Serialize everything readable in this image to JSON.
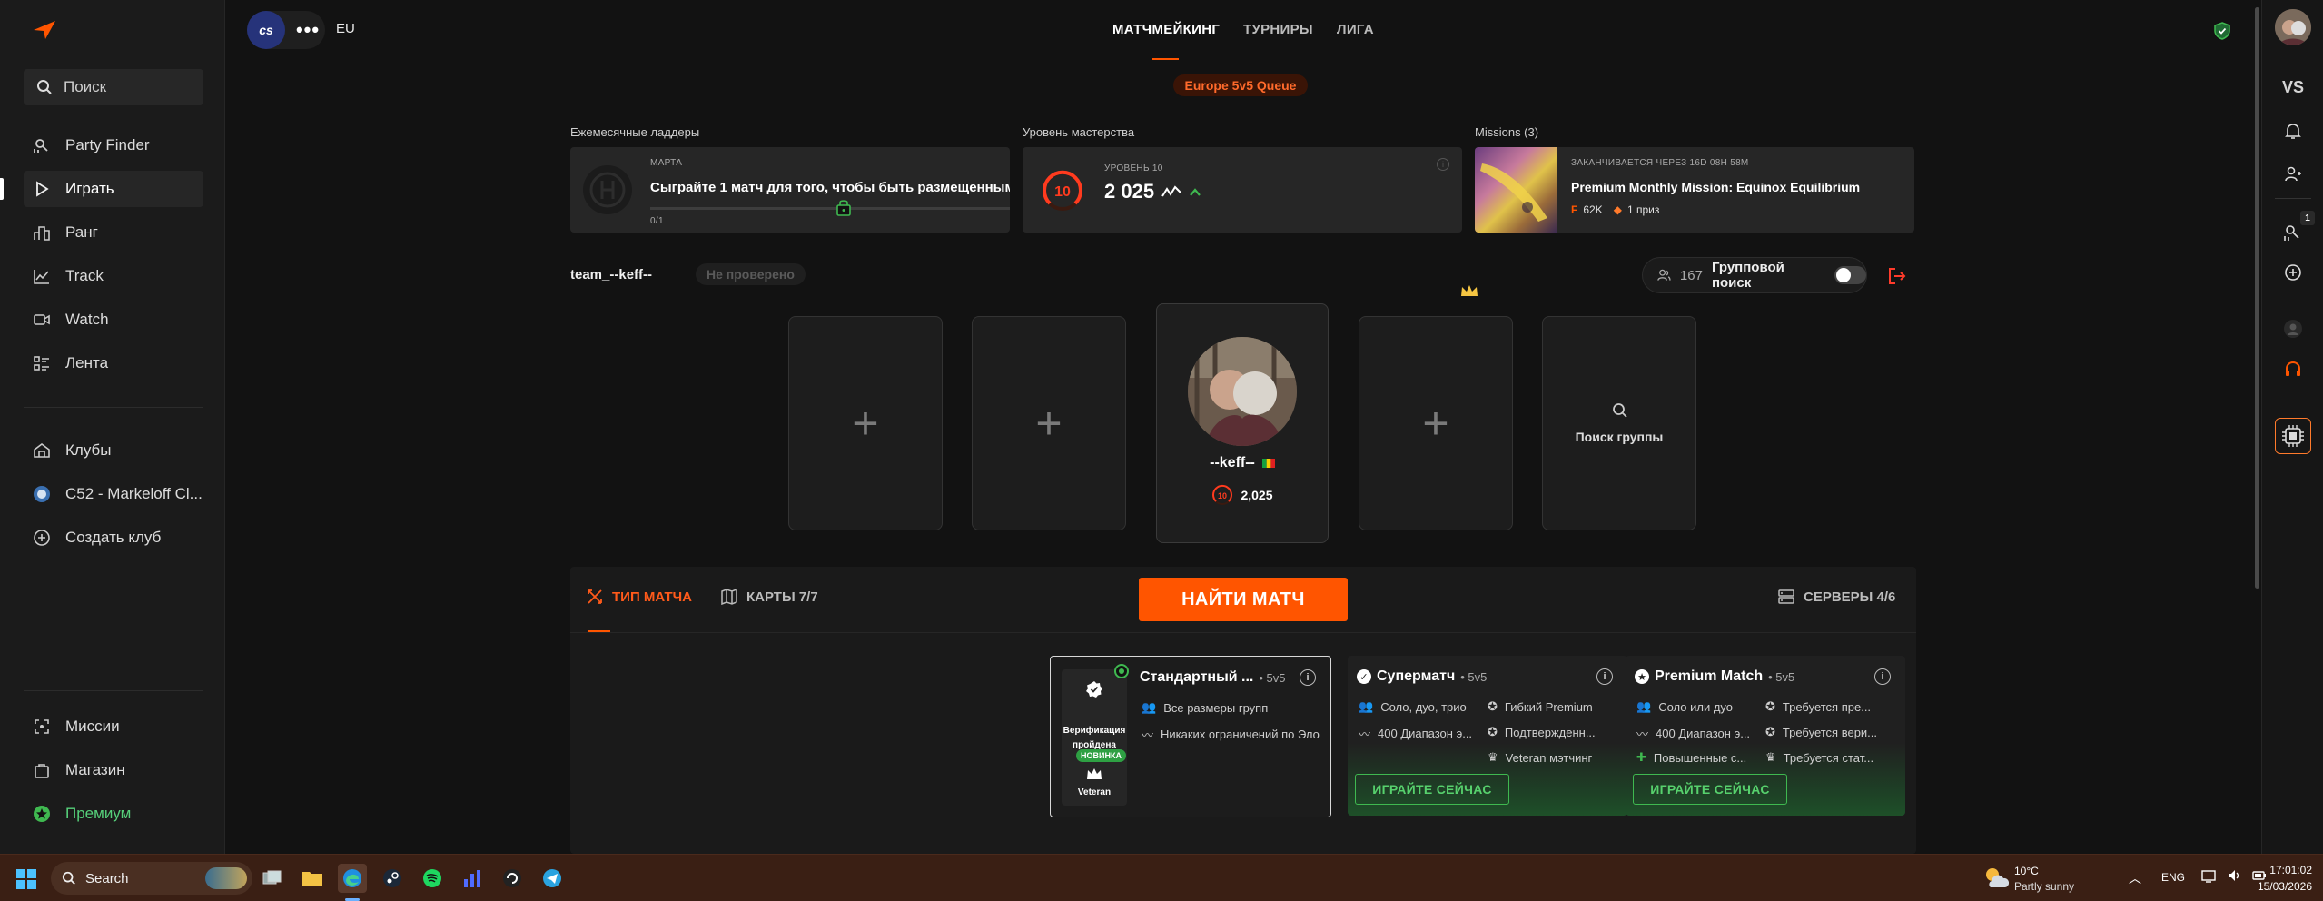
{
  "sidebar": {
    "search_label": "Поиск",
    "nav": [
      {
        "label": "Party Finder",
        "icon": "party-finder-icon"
      },
      {
        "label": "Играть",
        "icon": "play-icon"
      },
      {
        "label": "Ранг",
        "icon": "rank-icon"
      },
      {
        "label": "Track",
        "icon": "track-icon"
      },
      {
        "label": "Watch",
        "icon": "watch-icon"
      },
      {
        "label": "Лента",
        "icon": "feed-icon"
      }
    ],
    "clubs": [
      {
        "label": "Клубы"
      },
      {
        "label": "C52 - Markeloff Cl..."
      },
      {
        "label": "Создать клуб"
      }
    ],
    "bottom": [
      {
        "label": "Миссии"
      },
      {
        "label": "Магазин"
      },
      {
        "label": "Премиум"
      }
    ]
  },
  "topbar": {
    "game_logo": "cs",
    "region": "EU",
    "tabs": [
      "МАТЧМЕЙКИНГ",
      "ТУРНИРЫ",
      "ЛИГА"
    ],
    "active_tab": "МАТЧМЕЙКИНГ"
  },
  "queue_badge": "Europe 5v5 Queue",
  "ladder": {
    "section_label": "Ежемесячные ладдеры",
    "month": "МАРТА",
    "text": "Сыграйте 1 матч для того, чтобы быть размещенным",
    "progress": "0/1"
  },
  "mastery": {
    "section_label": "Уровень мастерства",
    "level_label": "УРОВЕНЬ 10",
    "level": "10",
    "elo": "2 025"
  },
  "missions": {
    "section_label": "Missions (3)",
    "ends": "ЗАКАНЧИВАЕТСЯ ЧЕРЕЗ 16D 08H 58M",
    "title": "Premium Monthly Mission: Equinox Equilibrium",
    "points": "62K",
    "prize": "1 приз"
  },
  "party": {
    "team_name": "team_--keff--",
    "verification": "Не проверено",
    "group_count": "167",
    "group_search_label": "Групповой поиск",
    "player_name": "--keff--",
    "player_level": "10",
    "player_elo": "2,025",
    "search_group_label": "Поиск группы"
  },
  "match_panel": {
    "tab_type": "ТИП МАТЧА",
    "tab_maps": "КАРТЫ 7/7",
    "find_button": "НАЙТИ МАТЧ",
    "servers": "СЕРВЕРЫ 4/6"
  },
  "modes": [
    {
      "title": "Стандартный ...",
      "format": "• 5v5",
      "badge_verified": "Верификация пройдена",
      "badge_new": "НОВИНКА",
      "badge_veteran": "Veteran",
      "features": [
        "Все размеры групп",
        "Никаких ограничений по Эло"
      ]
    },
    {
      "title": "Суперматч",
      "format": "• 5v5",
      "features": [
        "Соло, дуо, трио",
        "Гибкий Premium",
        "400 Диапазон э...",
        "Подтвержденн...",
        "Veteran мэтчинг"
      ],
      "play": "ИГРАЙТЕ СЕЙЧАС"
    },
    {
      "title": "Premium Match",
      "format": "• 5v5",
      "features": [
        "Соло или дуо",
        "Требуется пре...",
        "400 Диапазон э...",
        "Требуется вери...",
        "Повышенные с...",
        "Требуется стат..."
      ],
      "play": "ИГРАЙТЕ СЕЙЧАС"
    }
  ],
  "rail": {
    "vs_label": "VS",
    "party_badge": "1"
  },
  "taskbar": {
    "search": "Search",
    "weather_temp": "10°C",
    "weather_desc": "Partly sunny",
    "lang": "ENG",
    "time": "17:01:02",
    "date": "15/03/2026"
  },
  "colors": {
    "accent": "#ff5500",
    "green": "#3fb950",
    "background": "#121212"
  }
}
